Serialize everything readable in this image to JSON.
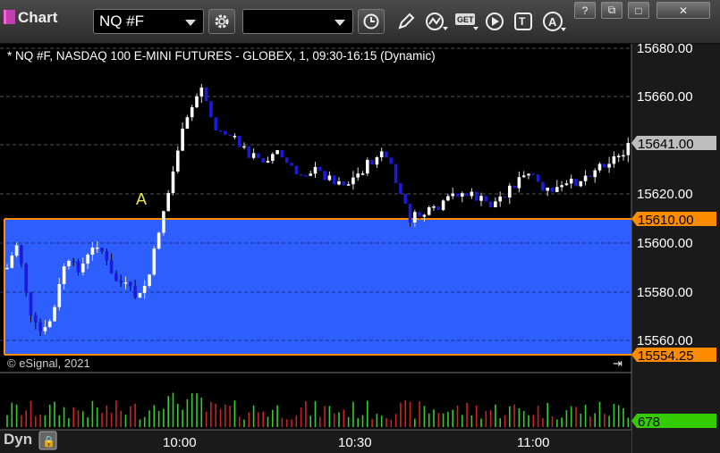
{
  "window": {
    "title": "Chart"
  },
  "toolbar": {
    "symbol": "NQ #F",
    "interval": "1",
    "buttons": [
      "settings-icon",
      "clock-icon",
      "pencil-icon",
      "studies-icon",
      "get-icon",
      "play-icon",
      "text-icon",
      "alert-icon"
    ]
  },
  "window_buttons": [
    "help-icon",
    "restore-icon",
    "maximize-icon",
    "close-icon"
  ],
  "chart": {
    "title": "* NQ #F, NASDAQ 100 E-MINI FUTURES - GLOBEX, 1, 09:30-16:15 (Dynamic)",
    "copyright": "© eSignal, 2021",
    "annotation": "A",
    "zone_color": "#2e5efc",
    "line_color": "#ff8c00",
    "up_color": "#ffffff",
    "down_color": "#1a1ad8",
    "price_labels": [
      "15680.00",
      "15660.00",
      "15640.00",
      "15620.00",
      "15600.00",
      "15580.00",
      "15560.00"
    ],
    "current_price": "15641.00",
    "upper_line_label": "15610.00",
    "lower_line_label": "15554.25",
    "time_labels": [
      "10:00",
      "10:30",
      "11:00"
    ],
    "volume_label": "678",
    "mode_label": "Dyn"
  },
  "chart_data": {
    "type": "candlestick",
    "ylim": [
      15550,
      15685
    ],
    "y_ticks": [
      15680,
      15660,
      15640,
      15620,
      15600,
      15580,
      15560
    ],
    "x_ticks": [
      "10:00",
      "10:30",
      "11:00"
    ],
    "horizontal_lines": [
      15610.0,
      15554.25
    ],
    "last_price": 15641.0,
    "volume_last": 678
  }
}
